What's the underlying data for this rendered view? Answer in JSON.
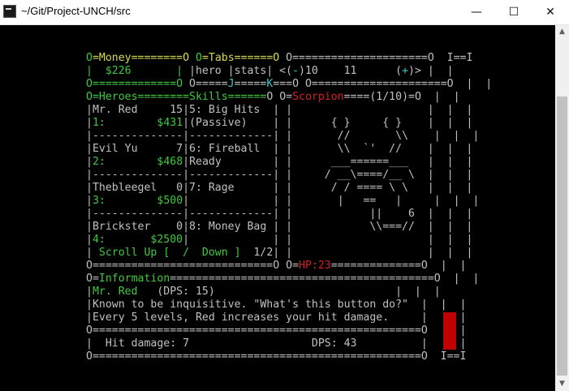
{
  "window": {
    "title": "~/Git/Project-UNCH/src",
    "minimize_symbol": "—",
    "maximize_symbol": "☐",
    "close_symbol": "✕"
  },
  "colors": {
    "green": "#3fc93f",
    "yellow": "#dada50",
    "red": "#d42020",
    "cyan": "#40c8c8",
    "white": "#c0c0c0",
    "background": "#000000",
    "hp_bar": "#c00000"
  },
  "rows": [
    [
      {
        "c": "g",
        "t": "O"
      },
      {
        "c": "y",
        "t": "=Money========O"
      },
      {
        "c": "w",
        "t": " "
      },
      {
        "c": "g",
        "t": "O"
      },
      {
        "c": "y",
        "t": "=Tabs======O"
      },
      {
        "c": "w",
        "t": " O=====================O  I==I"
      }
    ],
    [
      {
        "c": "g",
        "t": "|  $226       |"
      },
      {
        "c": "w",
        "t": " |hero |stats| <("
      },
      {
        "c": "c",
        "t": "-"
      },
      {
        "c": "w",
        "t": ")10    11      ("
      },
      {
        "c": "c",
        "t": "+"
      },
      {
        "c": "w",
        "t": ")> |  |"
      }
    ],
    [
      {
        "c": "g",
        "t": "O=============O"
      },
      {
        "c": "w",
        "t": " O====="
      },
      {
        "c": "c",
        "t": "J"
      },
      {
        "c": "w",
        "t": "====="
      },
      {
        "c": "c",
        "t": "K"
      },
      {
        "c": "w",
        "t": "===O O=====================O  |  |"
      }
    ],
    [
      {
        "c": "g",
        "t": "O=Heroes========Skills======"
      },
      {
        "c": "w",
        "t": "O O="
      },
      {
        "c": "r",
        "t": "Scorpion"
      },
      {
        "c": "w",
        "t": "====(1/10)=O  |  |"
      }
    ],
    [
      {
        "c": "w",
        "t": "|Mr. Red     15|5: Big Hits  | |                     |  |  |"
      }
    ],
    [
      {
        "c": "w",
        "t": "|"
      },
      {
        "c": "g",
        "t": "1:"
      },
      {
        "c": "w",
        "t": "        "
      },
      {
        "c": "g",
        "t": "$431"
      },
      {
        "c": "w",
        "t": "|(Passive)    | |      { }     { }    |  |  |"
      }
    ],
    [
      {
        "c": "w",
        "t": "|--------------|-------------| |       //       \\\\    |  |  |"
      }
    ],
    [
      {
        "c": "w",
        "t": "|Evil Yu      7|6: Fireball  | |       \\\\  `'  //    |  |  |"
      }
    ],
    [
      {
        "c": "w",
        "t": "|"
      },
      {
        "c": "g",
        "t": "2:"
      },
      {
        "c": "w",
        "t": "        "
      },
      {
        "c": "g",
        "t": "$468"
      },
      {
        "c": "w",
        "t": "|Ready        | |      ___======___   |  |  |"
      }
    ],
    [
      {
        "c": "w",
        "t": "|--------------|-------------| |     / __\\====/__ \\  |  |  |"
      }
    ],
    [
      {
        "c": "w",
        "t": "|Thebleegel   0|7: Rage      | |      / / ==== \\ \\   |  |  |"
      }
    ],
    [
      {
        "c": "w",
        "t": "|"
      },
      {
        "c": "g",
        "t": "3:"
      },
      {
        "c": "w",
        "t": "        "
      },
      {
        "c": "g",
        "t": "$500"
      },
      {
        "c": "w",
        "t": "|             | |       |   ==   |     |  |  |"
      }
    ],
    [
      {
        "c": "w",
        "t": "|--------------|-------------| |            ||    6  |  |  |"
      }
    ],
    [
      {
        "c": "w",
        "t": "|Brickster    0|8: Money Bag | |            \\\\===//  |  |  |"
      }
    ],
    [
      {
        "c": "w",
        "t": "|"
      },
      {
        "c": "g",
        "t": "4:"
      },
      {
        "c": "w",
        "t": "       "
      },
      {
        "c": "g",
        "t": "$2500"
      },
      {
        "c": "w",
        "t": "|             | |                     |  |  |"
      }
    ],
    [
      {
        "c": "w",
        "t": "| "
      },
      {
        "c": "g",
        "t": "Scroll Up [  /  Down ]"
      },
      {
        "c": "w",
        "t": "  1/2| |                     |  |  |"
      }
    ],
    [
      {
        "c": "w",
        "t": "O============================O O="
      },
      {
        "c": "r",
        "t": "HP:23"
      },
      {
        "c": "w",
        "t": "==============O  |  |"
      }
    ],
    [
      {
        "c": "w",
        "t": "O="
      },
      {
        "c": "g",
        "t": "Information"
      },
      {
        "c": "w",
        "t": "=========================================O  |  |"
      }
    ],
    [
      {
        "c": "w",
        "t": "|"
      },
      {
        "c": "g",
        "t": "Mr. Red"
      },
      {
        "c": "w",
        "t": "   (DPS: 15)                            |  |  |"
      }
    ],
    [
      {
        "c": "w",
        "t": "|Known to be inquisitive. \"What's this button do?\"  |  |  |"
      }
    ],
    [
      {
        "c": "w",
        "t": "|Every 5 levels, Red increases your hit damage.     |  |  |"
      }
    ],
    [
      {
        "c": "w",
        "t": "O===================================================O  |  |"
      }
    ],
    [
      {
        "c": "w",
        "t": "|  Hit damage: 7                   DPS: 43          |  |  |"
      }
    ],
    [
      {
        "c": "w",
        "t": "O===================================================O  I==I"
      }
    ]
  ]
}
